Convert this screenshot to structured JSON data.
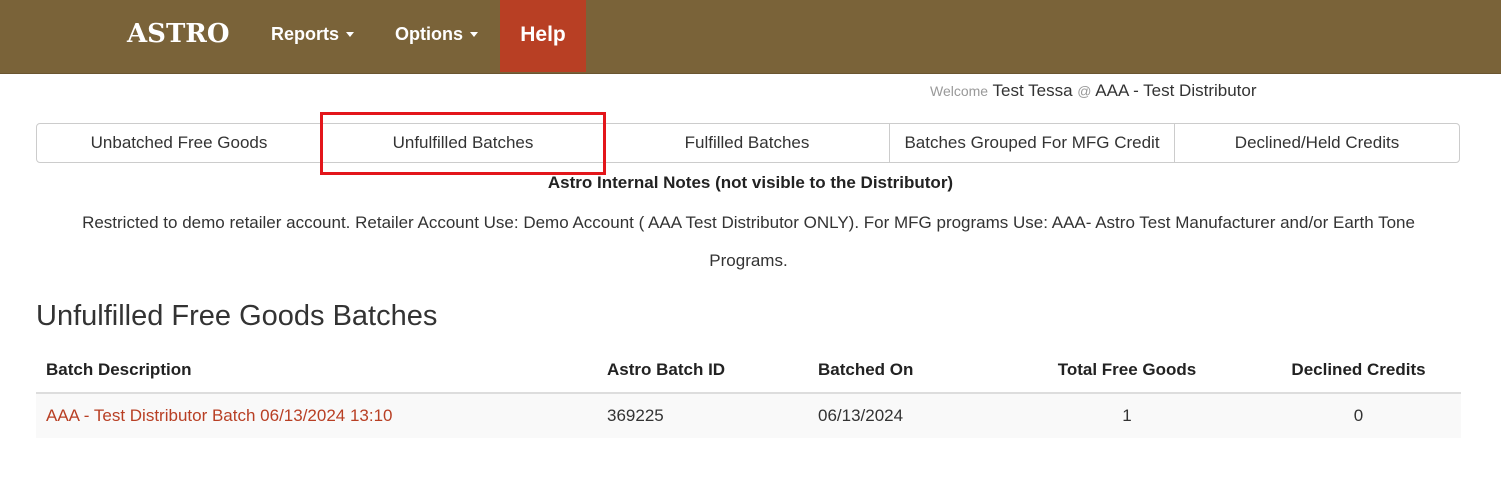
{
  "navbar": {
    "brand": "ASTRO",
    "items": [
      {
        "label": "Reports"
      },
      {
        "label": "Options"
      }
    ],
    "help_label": "Help",
    "bg_color": "#7a6339",
    "help_color": "#b83f24"
  },
  "welcome": {
    "prefix": "Welcome",
    "user": "Test Tessa",
    "at": "@",
    "distributor": "AAA - Test Distributor"
  },
  "tabs": [
    {
      "label": "Unbatched Free Goods"
    },
    {
      "label": "Unfulfilled Batches"
    },
    {
      "label": "Fulfilled Batches"
    },
    {
      "label": "Batches Grouped For MFG Credit"
    },
    {
      "label": "Declined/Held Credits"
    }
  ],
  "notes": {
    "title": "Astro Internal Notes (not visible to the Distributor)",
    "body": "Restricted to demo retailer account. Retailer Account Use: Demo Account ( AAA Test Distributor ONLY). For MFG programs Use: AAA- Astro Test Manufacturer and/or Earth Tone Programs."
  },
  "page_title": "Unfulfilled Free Goods Batches",
  "table": {
    "headers": [
      "Batch Description",
      "Astro Batch ID",
      "Batched On",
      "Total Free Goods",
      "Declined Credits"
    ],
    "rows": [
      {
        "description": "AAA - Test Distributor Batch 06/13/2024 13:10",
        "batch_id": "369225",
        "batched_on": "06/13/2024",
        "total_free_goods": "1",
        "declined_credits": "0"
      }
    ]
  }
}
